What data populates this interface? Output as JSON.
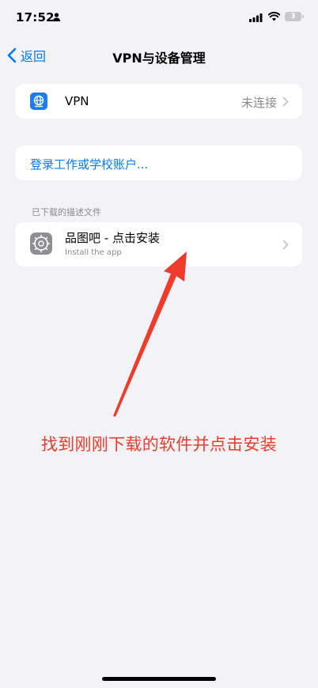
{
  "status_bar": {
    "time": "17:52",
    "battery_level": "3"
  },
  "nav": {
    "back_label": "返回",
    "title": "VPN与设备管理"
  },
  "vpn_row": {
    "label": "VPN",
    "status": "未连接"
  },
  "account_row": {
    "label": "登录工作或学校账户..."
  },
  "profiles_section": {
    "header": "已下载的描述文件",
    "item": {
      "name": "品图吧 - 点击安装",
      "subtitle": "Install the app"
    }
  },
  "annotation": {
    "text": "找到刚刚下载的软件并点击安装",
    "color": "#f03a2a"
  },
  "colors": {
    "accent": "#007aff",
    "background": "#f2f2f7",
    "vpn_icon": "#1e7bf0",
    "settings_icon": "#8e8e93"
  }
}
